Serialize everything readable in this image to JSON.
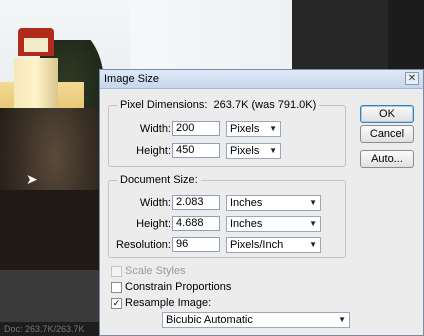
{
  "dialog": {
    "title": "Image Size",
    "close_icon": "close-icon",
    "pixel_dimensions": {
      "legend": "Pixel Dimensions:",
      "size_text": "263.7K (was 791.0K)",
      "width_label": "Width:",
      "width_value": "200",
      "width_unit": "Pixels",
      "height_label": "Height:",
      "height_value": "450",
      "height_unit": "Pixels"
    },
    "document_size": {
      "legend": "Document Size:",
      "width_label": "Width:",
      "width_value": "2.083",
      "width_unit": "Inches",
      "height_label": "Height:",
      "height_value": "4.688",
      "height_unit": "Inches",
      "resolution_label": "Resolution:",
      "resolution_value": "96",
      "resolution_unit": "Pixels/Inch"
    },
    "options": {
      "scale_styles": {
        "label": "Scale Styles",
        "checked": false,
        "enabled": false
      },
      "constrain_proportions": {
        "label": "Constrain Proportions",
        "checked": false
      },
      "resample_image": {
        "label": "Resample Image:",
        "checked": true
      },
      "resample_method": "Bicubic Automatic"
    },
    "buttons": {
      "ok": "OK",
      "cancel": "Cancel",
      "auto": "Auto..."
    }
  },
  "statusbar": {
    "text": "Doc: 263.7K/263.7K"
  },
  "colors": {
    "titlebar": "#c6d6ee",
    "dialog_bg": "#ececec",
    "ok_border": "#3c7fb1"
  }
}
